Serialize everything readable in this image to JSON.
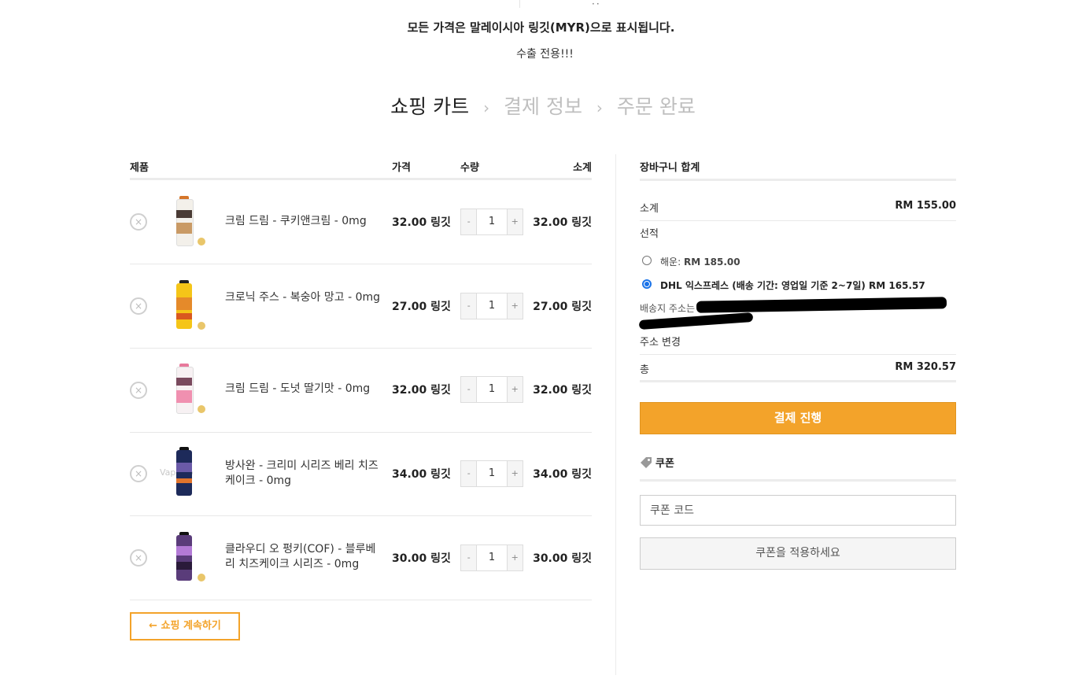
{
  "notice": {
    "line1": "모든 가격은 말레이시아 링깃(MYR)으로 표시됩니다.",
    "line2": "수출 전용!!!"
  },
  "steps": {
    "cart": "쇼핑 카트",
    "checkout": "결제 정보",
    "complete": "주문 완료",
    "separator": "›"
  },
  "cart": {
    "headers": {
      "product": "제품",
      "price": "가격",
      "quantity": "수량",
      "subtotal": "소계"
    },
    "items": [
      {
        "name": "크림 드림 - 쿠키앤크림 - 0mg",
        "price": "32.00 링깃",
        "qty": "1",
        "subtotal": "32.00 링깃"
      },
      {
        "name": "크로닉 주스 - 복숭아 망고 - 0mg",
        "price": "27.00 링깃",
        "qty": "1",
        "subtotal": "27.00 링깃"
      },
      {
        "name": "크림 드림 - 도넛 딸기맛 - 0mg",
        "price": "32.00 링깃",
        "qty": "1",
        "subtotal": "32.00 링깃"
      },
      {
        "name": "방사완 - 크리미 시리즈 베리 치즈케이크 - 0mg",
        "price": "34.00 링깃",
        "qty": "1",
        "subtotal": "34.00 링깃"
      },
      {
        "name": "클라우디 오 펑키(COF) - 블루베리 치즈케이크 시리즈 - 0mg",
        "price": "30.00 링깃",
        "qty": "1",
        "subtotal": "30.00 링깃"
      }
    ],
    "remove_symbol": "×",
    "minus": "-",
    "plus": "+",
    "continue_label": "← 쇼핑 계속하기"
  },
  "thumb_watermark": "Vap   rb",
  "totals": {
    "title": "장바구니 합계",
    "subtotal_label": "소계",
    "subtotal_value": "RM 155.00",
    "shipping_label": "선적",
    "options": [
      {
        "label": "해운:",
        "price": "RM 185.00",
        "selected": false
      },
      {
        "label": "DHL 익스프레스 (배송 기간: 영업일 기준 2~7일)",
        "price": "RM 165.57",
        "selected": true
      }
    ],
    "address_label": "배송지 주소는",
    "change_address": "주소 변경",
    "total_label": "총",
    "total_value": "RM 320.57",
    "checkout_button": "결제 진행"
  },
  "coupon": {
    "title": "쿠폰",
    "placeholder": "쿠폰 코드",
    "apply_button": "쿠폰을 적용하세요"
  },
  "colors": {
    "accent": "#f3a32a",
    "radio": "#1a73e8"
  }
}
